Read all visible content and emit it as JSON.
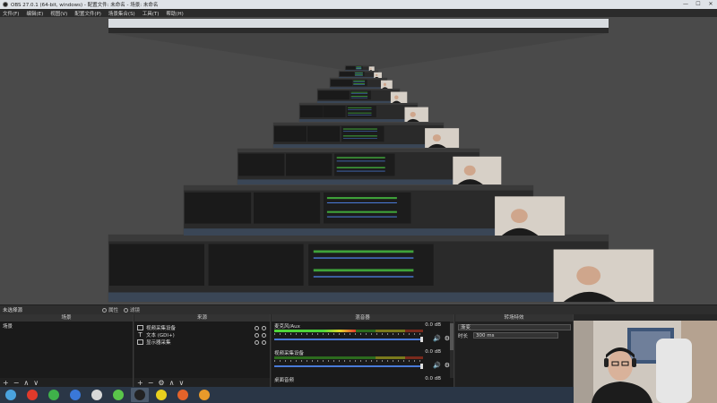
{
  "window": {
    "title": "OBS 27.0.1 (64-bit, windows) - 配置文件: 未命名 - 场景: 未命名",
    "controls": [
      "—",
      "☐",
      "✕"
    ]
  },
  "menu": [
    "文件(F)",
    "编辑(E)",
    "视图(V)",
    "配置文件(P)",
    "场景集合(S)",
    "工具(T)",
    "帮助(H)"
  ],
  "scene_bar": {
    "current_scene": "未选择源",
    "props_label": "属性",
    "filters_label": "滤镜"
  },
  "panels": {
    "scenes": {
      "title": "场景",
      "items": [
        "场景"
      ]
    },
    "sources": {
      "title": "来源",
      "items": [
        {
          "label": "视频采集设备",
          "icon": "camera-icon"
        },
        {
          "label": "文本 (GDI+)",
          "icon": "text-icon"
        },
        {
          "label": "显示器采集",
          "icon": "monitor-icon"
        }
      ]
    },
    "mixer": {
      "title": "混音器",
      "channels": [
        {
          "label": "麦克风/Aux",
          "db": "0.0 dB",
          "level": 0.55
        },
        {
          "label": "视频采集设备",
          "db": "0.0 dB",
          "level": 0.0
        },
        {
          "label": "桌面音频",
          "db": "0.0 dB",
          "level": 0.0
        }
      ]
    },
    "transitions": {
      "title": "转场特效",
      "type_value": "渐变",
      "duration_label": "时长",
      "duration_value": "300 ms"
    }
  },
  "footer_buttons": {
    "add": "+",
    "remove": "−",
    "up": "∧",
    "down": "∨",
    "settings": "⚙"
  },
  "status": {
    "right_text": "OBS"
  },
  "taskbar": {
    "apps": [
      {
        "name": "start-icon",
        "color": "#4aa3df"
      },
      {
        "name": "qq-icon",
        "color": "#e03a2b"
      },
      {
        "name": "media-player-icon",
        "color": "#3fb24a"
      },
      {
        "name": "sogou-icon",
        "color": "#3a78d8"
      },
      {
        "name": "game-icon",
        "color": "#d8d8d8"
      },
      {
        "name": "wechat-icon",
        "color": "#5ac54a"
      },
      {
        "name": "obs-icon",
        "color": "#222222"
      },
      {
        "name": "record-icon",
        "color": "#e8d01e"
      },
      {
        "name": "browser-icon",
        "color": "#e4632a"
      },
      {
        "name": "folder-icon",
        "color": "#e89a2a"
      }
    ]
  }
}
